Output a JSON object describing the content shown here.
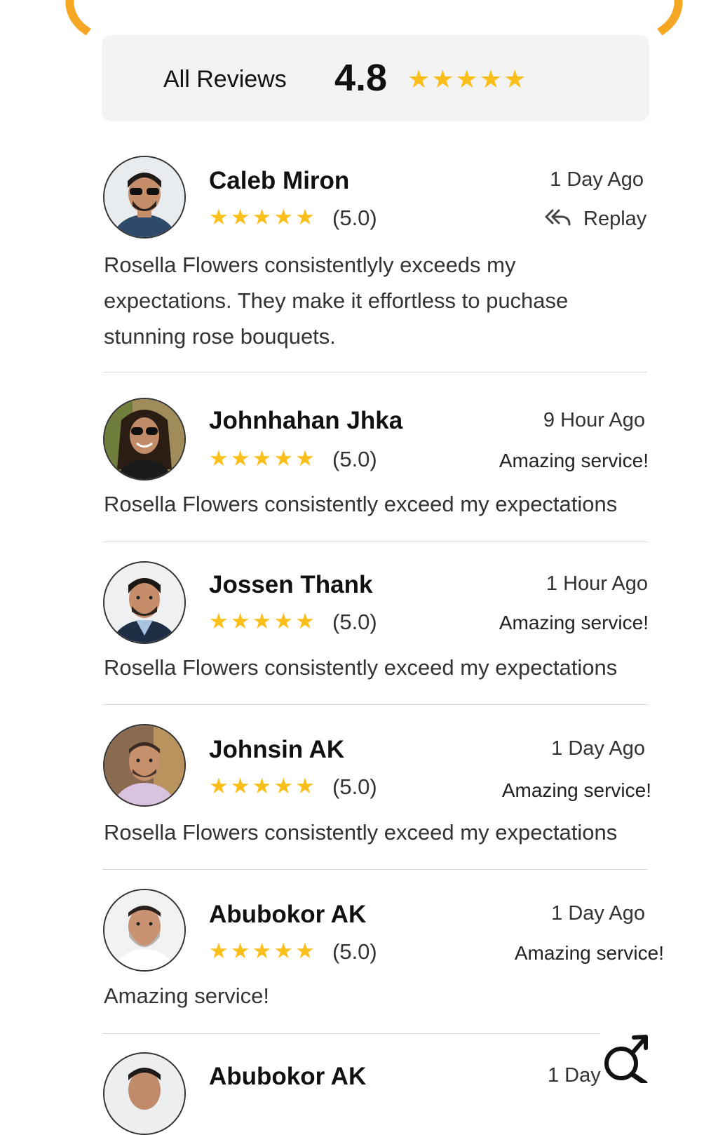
{
  "summary": {
    "label": "All Reviews",
    "score": "4.8",
    "stars": "★★★★★"
  },
  "colors": {
    "accent": "#f5a623",
    "star": "#fbbf1c"
  },
  "reviews": [
    {
      "name": "Caleb Miron",
      "stars": "★★★★★",
      "rating": "(5.0)",
      "time": "1 Day Ago",
      "action": "Replay",
      "lines": [
        "Rosella Flowers consistentlyly exceeds my",
        "expectations. They make it effortless to puchase",
        "stunning rose bouquets."
      ]
    },
    {
      "name": "Johnhahan Jhka",
      "stars": "★★★★★",
      "rating": "(5.0)",
      "time": "9 Hour Ago",
      "tag": "Amazing service!",
      "lines": [
        "Rosella Flowers consistently exceed my expectations"
      ]
    },
    {
      "name": "Jossen Thank",
      "stars": "★★★★★",
      "rating": "(5.0)",
      "time": "1 Hour Ago",
      "tag": "Amazing service!",
      "lines": [
        "Rosella Flowers consistently exceed my expectations"
      ]
    },
    {
      "name": "Johnsin AK",
      "stars": "★★★★★",
      "rating": "(5.0)",
      "time": "1 Day Ago",
      "tag": "Amazing service!",
      "lines": [
        "Rosella Flowers consistently exceed my expectations"
      ]
    },
    {
      "name": "Abubokor AK",
      "stars": "★★★★★",
      "rating": "(5.0)",
      "time": "1 Day Ago",
      "tag": "Amazing service!",
      "lines": [
        "Amazing service!"
      ]
    },
    {
      "name": "Abubokor AK",
      "time": "1 Day"
    }
  ],
  "icons": {
    "reply": "reply-all-icon",
    "search": "search-icon"
  }
}
